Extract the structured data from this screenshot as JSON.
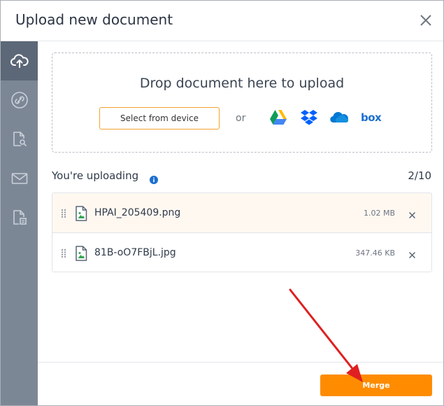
{
  "dialog": {
    "title": "Upload new document"
  },
  "sidebar": {
    "items": [
      {
        "name": "upload",
        "icon": "cloud-upload-icon",
        "active": true
      },
      {
        "name": "link",
        "icon": "link-icon",
        "active": false
      },
      {
        "name": "search-document",
        "icon": "document-search-icon",
        "active": false
      },
      {
        "name": "email",
        "icon": "envelope-icon",
        "active": false
      },
      {
        "name": "template",
        "icon": "document-template-icon",
        "active": false
      }
    ]
  },
  "dropzone": {
    "title": "Drop document here to upload",
    "select_label": "Select from device",
    "or_label": "or",
    "services": [
      "google-drive-icon",
      "dropbox-icon",
      "onedrive-icon",
      "box-icon"
    ],
    "box_label": "box"
  },
  "uploading": {
    "label": "You're uploading",
    "count": "2/10",
    "files": [
      {
        "name": "HPAI_205409.png",
        "size": "1.02 MB"
      },
      {
        "name": "81B-oO7FBjL.jpg",
        "size": "347.46 KB"
      }
    ]
  },
  "footer": {
    "merge_label": "Merge"
  },
  "colors": {
    "accent": "#ff8c00",
    "sidebar": "#7c8796",
    "sidebar_active": "#5c6777",
    "select_border": "#f3a230",
    "arrow": "#e02020"
  }
}
